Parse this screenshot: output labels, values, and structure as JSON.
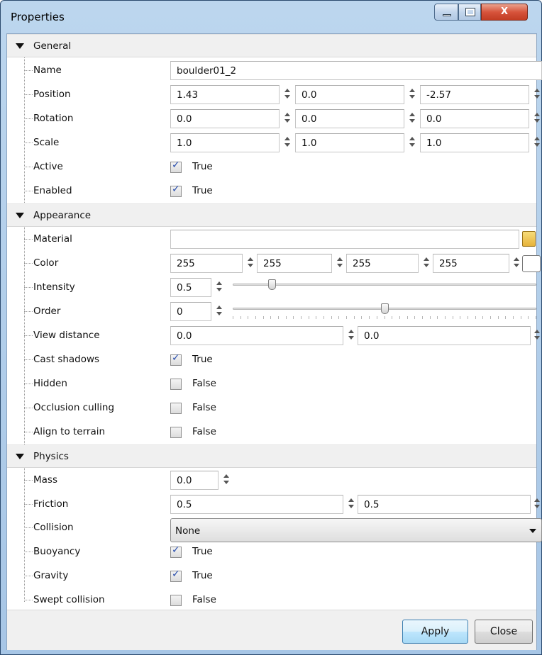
{
  "window": {
    "title": "Properties"
  },
  "sections": {
    "general": "General",
    "appearance": "Appearance",
    "physics": "Physics"
  },
  "general": {
    "name": {
      "label": "Name",
      "value": "boulder01_2"
    },
    "position": {
      "label": "Position",
      "values": [
        "1.43",
        "0.0",
        "-2.57"
      ]
    },
    "rotation": {
      "label": "Rotation",
      "values": [
        "0.0",
        "0.0",
        "0.0"
      ]
    },
    "scale": {
      "label": "Scale",
      "values": [
        "1.0",
        "1.0",
        "1.0"
      ]
    },
    "active": {
      "label": "Active",
      "checked": true,
      "text": "True"
    },
    "enabled": {
      "label": "Enabled",
      "checked": true,
      "text": "True"
    }
  },
  "appearance": {
    "material": {
      "label": "Material",
      "value": ""
    },
    "color": {
      "label": "Color",
      "values": [
        "255",
        "255",
        "255",
        "255"
      ],
      "swatch": "#ffffff"
    },
    "intensity": {
      "label": "Intensity",
      "value": "0.5",
      "slider_fraction": 0.12
    },
    "order": {
      "label": "Order",
      "value": "0",
      "slider_fraction": 0.5
    },
    "view_distance": {
      "label": "View distance",
      "values": [
        "0.0",
        "0.0"
      ]
    },
    "cast_shadows": {
      "label": "Cast shadows",
      "checked": true,
      "text": "True"
    },
    "hidden": {
      "label": "Hidden",
      "checked": false,
      "text": "False"
    },
    "occlusion_culling": {
      "label": "Occlusion culling",
      "checked": false,
      "text": "False"
    },
    "align_to_terrain": {
      "label": "Align to terrain",
      "checked": false,
      "text": "False"
    }
  },
  "physics": {
    "mass": {
      "label": "Mass",
      "value": "0.0"
    },
    "friction": {
      "label": "Friction",
      "values": [
        "0.5",
        "0.5"
      ]
    },
    "collision": {
      "label": "Collision",
      "value": "None"
    },
    "buoyancy": {
      "label": "Buoyancy",
      "checked": true,
      "text": "True"
    },
    "gravity": {
      "label": "Gravity",
      "checked": true,
      "text": "True"
    },
    "swept_collision": {
      "label": "Swept collision",
      "checked": false,
      "text": "False"
    }
  },
  "buttons": {
    "apply": "Apply",
    "close": "Close"
  },
  "window_buttons": {
    "close_glyph": "X"
  },
  "icons": [
    "minimize-icon",
    "maximize-icon",
    "close-icon",
    "chevron-down-icon",
    "spin-arrows-icon",
    "folder-icon",
    "check-icon"
  ]
}
